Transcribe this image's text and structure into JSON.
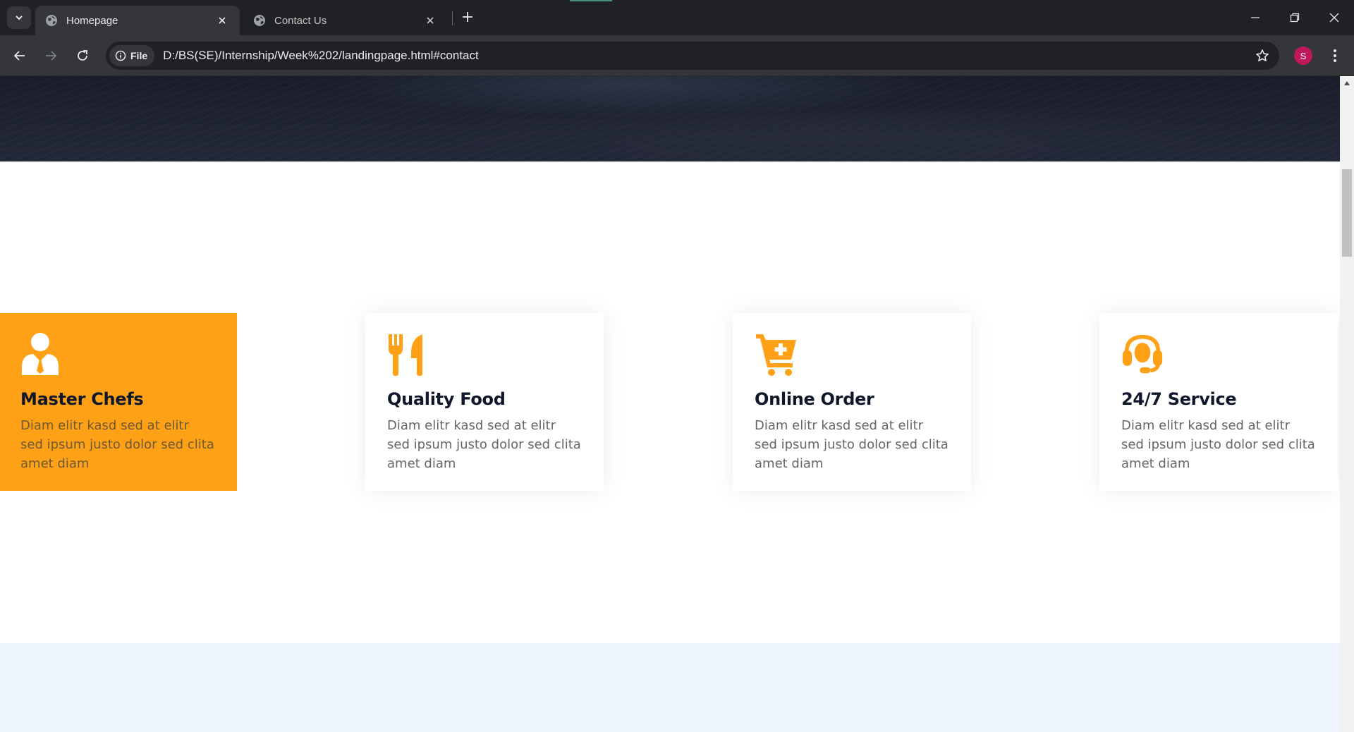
{
  "browser": {
    "tabs": [
      {
        "title": "Homepage",
        "active": true,
        "icon": "globe-icon"
      },
      {
        "title": "Contact Us",
        "active": false,
        "icon": "globe-icon"
      }
    ],
    "new_tab_label": "+",
    "site_chip_label": "File",
    "url": "D:/BS(SE)/Internship/Week%202/landingpage.html#contact",
    "profile_initial": "S",
    "profile_color": "#c2185b"
  },
  "services": [
    {
      "icon": "master-chef-icon",
      "title": "Master Chefs",
      "text": "Diam elitr kasd sed at elitr sed ipsum justo dolor sed clita amet diam",
      "highlighted": true
    },
    {
      "icon": "utensils-icon",
      "title": "Quality Food",
      "text": "Diam elitr kasd sed at elitr sed ipsum justo dolor sed clita amet diam",
      "highlighted": false
    },
    {
      "icon": "cart-plus-icon",
      "title": "Online Order",
      "text": "Diam elitr kasd sed at elitr sed ipsum justo dolor sed clita amet diam",
      "highlighted": false
    },
    {
      "icon": "headset-icon",
      "title": "24/7 Service",
      "text": "Diam elitr kasd sed at elitr sed ipsum justo dolor sed clita amet diam",
      "highlighted": false
    }
  ],
  "colors": {
    "accent": "#fea116",
    "heading": "#0f172b",
    "body_text": "#666565",
    "hero_bg": "#1e2230",
    "next_section_bg": "#eef5fd"
  }
}
